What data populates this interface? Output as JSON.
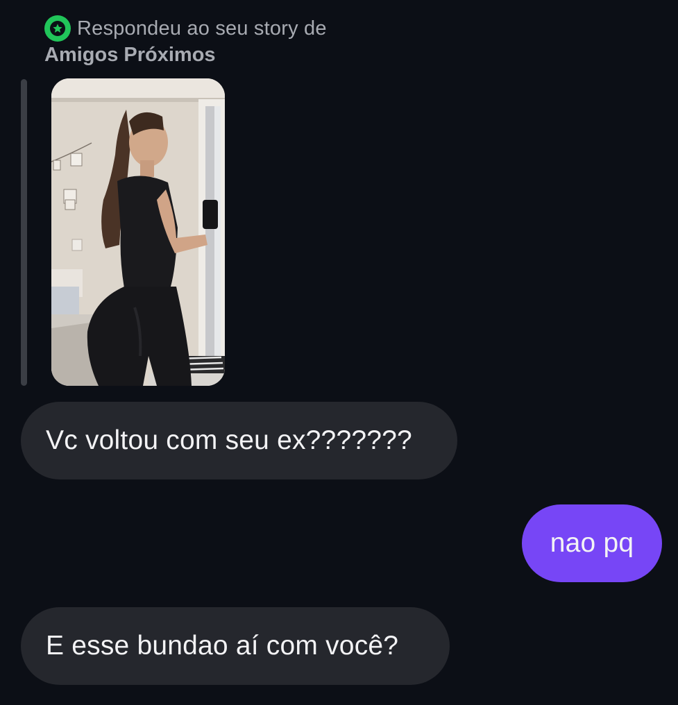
{
  "story_reply": {
    "line1": "Respondeu ao seu story de",
    "line2": "Amigos Próximos",
    "badge_icon": "close-friends-star-icon",
    "badge_color": "#21c55a"
  },
  "story_preview": {
    "icon": "story-image"
  },
  "messages": [
    {
      "side": "received",
      "text": "Vc voltou com seu ex???????"
    },
    {
      "side": "sent",
      "text": "nao pq"
    },
    {
      "side": "received",
      "text": "E esse bundao aí com você?"
    }
  ],
  "colors": {
    "background": "#0c0f16",
    "received_bubble": "#25272d",
    "sent_bubble": "#7746f6",
    "text_primary": "#f3f3f5",
    "text_secondary": "#a8abb2"
  }
}
